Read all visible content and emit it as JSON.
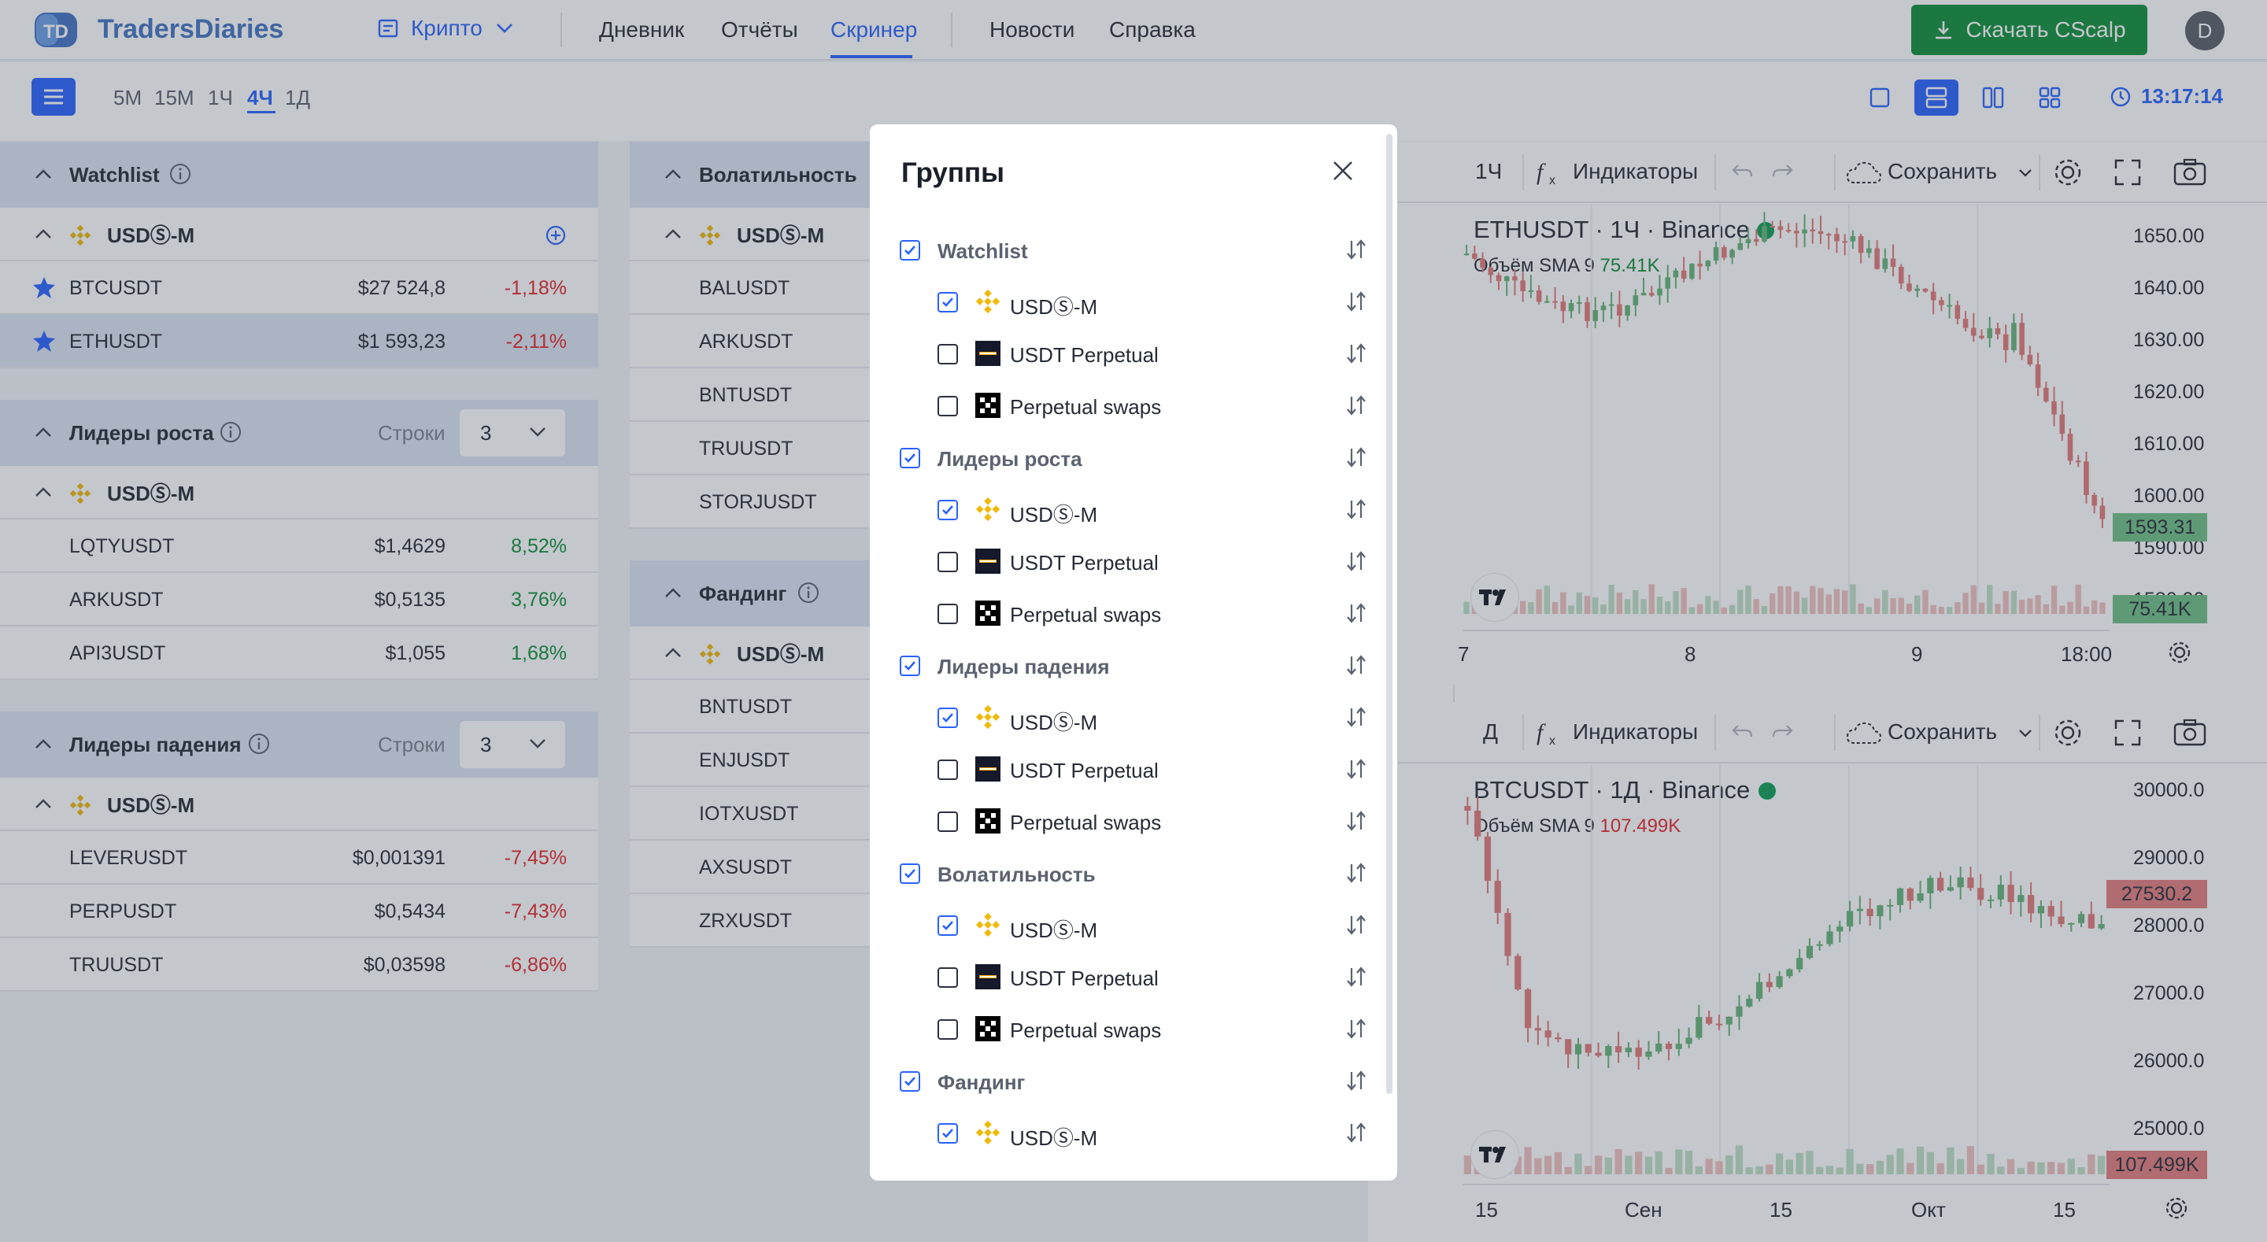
{
  "app": {
    "brand": "TradersDiaries",
    "logo_text": "TD"
  },
  "header": {
    "market": "Крипто",
    "nav": [
      "Дневник",
      "Отчёты",
      "Скринер",
      "Новости",
      "Справка"
    ],
    "active_nav": "Скринер",
    "download_label": "Скачать CScalp",
    "avatar": "D"
  },
  "toolbar": {
    "timeframes": [
      "5М",
      "15М",
      "1Ч",
      "4Ч",
      "1Д"
    ],
    "active_timeframe": "4Ч",
    "time": "13:17:14"
  },
  "panels": {
    "watchlist": {
      "title": "Watchlist",
      "group": "USDⓈ-M",
      "rows": [
        {
          "symbol": "BTCUSDT",
          "price": "$27 524,8",
          "change": "-1,18%"
        },
        {
          "symbol": "ETHUSDT",
          "price": "$1 593,23",
          "change": "-2,11%"
        }
      ]
    },
    "gainers": {
      "title": "Лидеры роста",
      "rows_label": "Строки",
      "rows_value": "3",
      "group": "USDⓈ-M",
      "rows": [
        {
          "symbol": "LQTYUSDT",
          "price": "$1,4629",
          "change": "8,52%"
        },
        {
          "symbol": "ARKUSDT",
          "price": "$0,5135",
          "change": "3,76%"
        },
        {
          "symbol": "API3USDT",
          "price": "$1,055",
          "change": "1,68%"
        }
      ]
    },
    "losers": {
      "title": "Лидеры падения",
      "rows_label": "Строки",
      "rows_value": "3",
      "group": "USDⓈ-M",
      "rows": [
        {
          "symbol": "LEVERUSDT",
          "price": "$0,001391",
          "change": "-7,45%"
        },
        {
          "symbol": "PERPUSDT",
          "price": "$0,5434",
          "change": "-7,43%"
        },
        {
          "symbol": "TRUUSDT",
          "price": "$0,03598",
          "change": "-6,86%"
        }
      ]
    },
    "volatility": {
      "title": "Волатильность",
      "group": "USDⓈ-M",
      "rows": [
        "BALUSDT",
        "ARKUSDT",
        "BNTUSDT",
        "TRUUSDT",
        "STORJUSDT"
      ]
    },
    "funding": {
      "title": "Фандинг",
      "group": "USDⓈ-M",
      "rows": [
        "BNTUSDT",
        "ENJUSDT",
        "IOTXUSDT",
        "AXSUSDT",
        "ZRXUSDT"
      ]
    }
  },
  "charts": {
    "top": {
      "interval": "1Ч",
      "indicators": "Индикаторы",
      "save": "Сохранить",
      "title": "ETHUSDT · 1Ч · Binance",
      "vol_label": "Объём SMA 9",
      "vol_value": "75.41K",
      "y_ticks": [
        "1650.00",
        "1640.00",
        "1630.00",
        "1620.00",
        "1610.00",
        "1600.00",
        "1590.00",
        "1580.00"
      ],
      "price": "1593.31",
      "vol_badge": "75.41K",
      "x_labels": [
        "7",
        "8",
        "9",
        "18:00"
      ]
    },
    "bottom": {
      "interval": "Д",
      "indicators": "Индикаторы",
      "save": "Сохранить",
      "title": "BTCUSDT · 1Д · Binance",
      "vol_label": "Объём SMA 9",
      "vol_value": "107.499K",
      "y_ticks": [
        "30000.0",
        "29000.0",
        "28000.0",
        "27000.0",
        "26000.0",
        "25000.0"
      ],
      "price": "27530.2",
      "vol_badge": "107.499K",
      "x_labels": [
        "15",
        "Сен",
        "15",
        "Окт",
        "15"
      ]
    }
  },
  "modal": {
    "title": "Группы",
    "rows": [
      {
        "label": "Watchlist",
        "group": true,
        "checked": true
      },
      {
        "label": "USDⓈ-M",
        "icon": "binance",
        "checked": true
      },
      {
        "label": "USDT Perpetual",
        "icon": "bybit",
        "checked": false
      },
      {
        "label": "Perpetual swaps",
        "icon": "okx",
        "checked": false
      },
      {
        "label": "Лидеры роста",
        "group": true,
        "checked": true
      },
      {
        "label": "USDⓈ-M",
        "icon": "binance",
        "checked": true
      },
      {
        "label": "USDT Perpetual",
        "icon": "bybit",
        "checked": false
      },
      {
        "label": "Perpetual swaps",
        "icon": "okx",
        "checked": false
      },
      {
        "label": "Лидеры падения",
        "group": true,
        "checked": true
      },
      {
        "label": "USDⓈ-M",
        "icon": "binance",
        "checked": true
      },
      {
        "label": "USDT Perpetual",
        "icon": "bybit",
        "checked": false
      },
      {
        "label": "Perpetual swaps",
        "icon": "okx",
        "checked": false
      },
      {
        "label": "Волатильность",
        "group": true,
        "checked": true
      },
      {
        "label": "USDⓈ-M",
        "icon": "binance",
        "checked": true
      },
      {
        "label": "USDT Perpetual",
        "icon": "bybit",
        "checked": false
      },
      {
        "label": "Perpetual swaps",
        "icon": "okx",
        "checked": false
      },
      {
        "label": "Фандинг",
        "group": true,
        "checked": true
      },
      {
        "label": "USDⓈ-M",
        "icon": "binance",
        "checked": true
      }
    ]
  },
  "colors": {
    "accent": "#2962ff",
    "positive": "#0f8f3a",
    "negative": "#e5262d",
    "header_bg": "#dbe4f2"
  }
}
